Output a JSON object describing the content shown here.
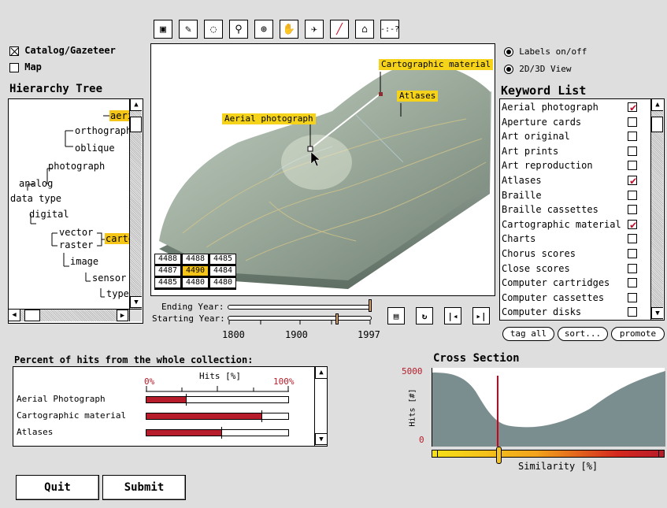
{
  "toolbar": {
    "tools": [
      {
        "icon": "save-icon",
        "glyph": "▣"
      },
      {
        "icon": "edit-image-icon",
        "glyph": "✎"
      },
      {
        "icon": "lasso-select-icon",
        "glyph": "◌"
      },
      {
        "icon": "zoom-icon",
        "glyph": "⚲"
      },
      {
        "icon": "crosshair-icon",
        "glyph": "⊕"
      },
      {
        "icon": "hand-pan-icon",
        "glyph": "✋"
      },
      {
        "icon": "satellite-icon",
        "glyph": "✈"
      },
      {
        "icon": "line-draw-icon",
        "glyph": "╱"
      },
      {
        "icon": "polygon-icon",
        "glyph": "⌂"
      },
      {
        "icon": "help-cursor-icon",
        "glyph": "-:-?"
      }
    ]
  },
  "left": {
    "catalog_label": "Catalog/Gazeteer",
    "catalog_checked": true,
    "map_label": "Map",
    "map_checked": false,
    "hierarchy_title": "Hierarchy Tree",
    "tree": {
      "aerial": "aeria",
      "orthographic": "orthographi",
      "oblique": "oblique",
      "photograph": "photograph",
      "analog": "analog",
      "data_type": "data type",
      "digital": "digital",
      "vector": "vector",
      "raster": "raster",
      "carto": "carto",
      "image": "image",
      "sensor": "sensor",
      "type": "type"
    }
  },
  "viewer": {
    "callouts": {
      "cartographic": "Cartographic material",
      "atlases": "Atlases",
      "aerial": "Aerial photograph"
    },
    "grid": [
      [
        "4488",
        "4488",
        "4485"
      ],
      [
        "4487",
        "4490",
        "4484"
      ],
      [
        "4485",
        "4480",
        "4480"
      ]
    ],
    "grid_highlight": "4490"
  },
  "time": {
    "ending_label": "Ending Year:",
    "starting_label": "Starting Year:",
    "ticks": [
      "1800",
      "1900",
      "1997"
    ],
    "ending_value": 1997,
    "starting_value": 1940,
    "min": 1750,
    "max": 1997
  },
  "options": {
    "labels_toggle": "Labels on/off",
    "view_toggle": "2D/3D View"
  },
  "keywords": {
    "title": "Keyword List",
    "items": [
      {
        "label": "Aerial photograph",
        "checked": true
      },
      {
        "label": "Aperture cards",
        "checked": false
      },
      {
        "label": "Art original",
        "checked": false
      },
      {
        "label": "Art prints",
        "checked": false
      },
      {
        "label": "Art reproduction",
        "checked": false
      },
      {
        "label": "Atlases",
        "checked": true
      },
      {
        "label": "Braille",
        "checked": false
      },
      {
        "label": "Braille cassettes",
        "checked": false
      },
      {
        "label": "Cartographic material",
        "checked": true
      },
      {
        "label": "Charts",
        "checked": false
      },
      {
        "label": "Chorus scores",
        "checked": false
      },
      {
        "label": "Close scores",
        "checked": false
      },
      {
        "label": "Computer cartridges",
        "checked": false
      },
      {
        "label": "Computer cassettes",
        "checked": false
      },
      {
        "label": "Computer disks",
        "checked": false
      }
    ],
    "tag_all": "tag all",
    "sort": "sort...",
    "promote": "promote"
  },
  "percent": {
    "title": "Percent of hits from the whole collection:",
    "axis_label": "Hits [%]",
    "min_label": "0%",
    "max_label": "100%",
    "rows": [
      {
        "label": "Aerial Photograph",
        "value": 0.28
      },
      {
        "label": "Cartographic material",
        "value": 0.81
      },
      {
        "label": "Atlases",
        "value": 0.53
      }
    ]
  },
  "cross_section": {
    "title": "Cross Section",
    "ylabel": "Hits [#]",
    "ymax_label": "5000",
    "ymin_label": "0",
    "xlabel": "Similarity [%]",
    "marker_position": 0.33
  },
  "buttons": {
    "quit": "Quit",
    "submit": "Submit"
  },
  "colors": {
    "highlight": "#f5c518",
    "accent_red": "#b71c2a",
    "terrain": "#9aa89f",
    "cross_fill": "#7b8e8f"
  }
}
